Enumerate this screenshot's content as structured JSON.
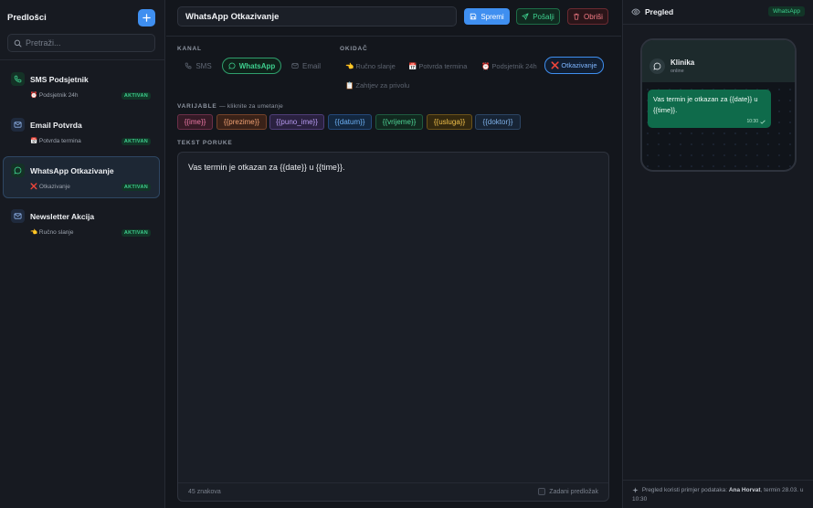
{
  "sidebar": {
    "title": "Predlošci",
    "search_placeholder": "Pretraži...",
    "templates": [
      {
        "name": "SMS Podsjetnik",
        "trigger": "⏰ Podsjetnik 24h",
        "status": "AKTIVAN",
        "icon": "phone-icon"
      },
      {
        "name": "Email Potvrda",
        "trigger": "📅 Potvrda termina",
        "status": "AKTIVAN",
        "icon": "mail-icon"
      },
      {
        "name": "WhatsApp Otkazivanje",
        "trigger": "❌ Otkazivanje",
        "status": "AKTIVAN",
        "icon": "chat-icon",
        "active": true
      },
      {
        "name": "Newsletter Akcija",
        "trigger": "👈 Ručno slanje",
        "status": "AKTIVAN",
        "icon": "mail-icon"
      }
    ]
  },
  "editor": {
    "title_value": "WhatsApp Otkazivanje",
    "save_label": "Spremi",
    "send_label": "Pošalji",
    "delete_label": "Obriši",
    "channel_label": "KANAL",
    "channels": [
      "SMS",
      "WhatsApp",
      "Email"
    ],
    "active_channel": "WhatsApp",
    "trigger_label": "OKIDAČ",
    "triggers": [
      "👈 Ručno slanje",
      "📅 Potvrda termina",
      "⏰ Podsjetnik 24h",
      "❌ Otkazivanje",
      "📋 Zahtjev za privolu"
    ],
    "active_trigger": "❌ Otkazivanje",
    "variables_label": "VARIJABLE",
    "variables_hint": "— kliknite za umetanje",
    "variables": [
      "{{ime}}",
      "{{prezime}}",
      "{{puno_ime}}",
      "{{datum}}",
      "{{vrijeme}}",
      "{{usluga}}",
      "{{doktor}}"
    ],
    "text_label": "TEKST PORUKE",
    "message_text": "Vas termin je otkazan za {{date}} u {{time}}.",
    "char_count": "45 znakova",
    "default_label": "Zadani predložak"
  },
  "preview": {
    "title": "Pregled",
    "channel_badge": "WhatsApp",
    "contact_name": "Klinika",
    "contact_status": "online",
    "bubble_text": "Vas termin je otkazan za {{date}} u {{time}}.",
    "bubble_time": "10:30",
    "footer_prefix": "Pregled koristi primjer podataka:",
    "footer_name": "Ana Horvat",
    "footer_suffix": ", termin 28.03. u 10:30"
  },
  "colors": {
    "accent": "#3f8ff0",
    "success": "#3ecf8e",
    "danger": "#f47b85",
    "whatsapp_bubble": "#0f6b4b"
  }
}
